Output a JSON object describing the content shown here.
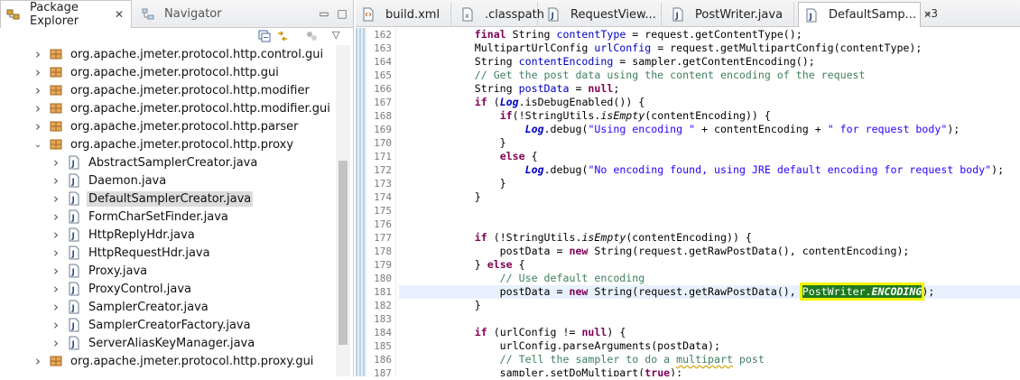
{
  "left_view": {
    "tabs": [
      {
        "label": "Package Explorer",
        "icon": "package-explorer-icon",
        "active": true
      },
      {
        "label": "Navigator",
        "icon": "navigator-icon",
        "active": false
      }
    ],
    "tree": [
      {
        "label": "org.apache.jmeter.protocol.http.control.gui",
        "indent": 1,
        "expander": "collapsed",
        "icon": "package-icon"
      },
      {
        "label": "org.apache.jmeter.protocol.http.gui",
        "indent": 1,
        "expander": "collapsed",
        "icon": "package-icon"
      },
      {
        "label": "org.apache.jmeter.protocol.http.modifier",
        "indent": 1,
        "expander": "collapsed",
        "icon": "package-icon"
      },
      {
        "label": "org.apache.jmeter.protocol.http.modifier.gui",
        "indent": 1,
        "expander": "collapsed",
        "icon": "package-icon"
      },
      {
        "label": "org.apache.jmeter.protocol.http.parser",
        "indent": 1,
        "expander": "collapsed",
        "icon": "package-icon"
      },
      {
        "label": "org.apache.jmeter.protocol.http.proxy",
        "indent": 1,
        "expander": "expanded",
        "icon": "package-icon"
      },
      {
        "label": "AbstractSamplerCreator.java",
        "indent": 2,
        "expander": "collapsed",
        "icon": "java-file-icon"
      },
      {
        "label": "Daemon.java",
        "indent": 2,
        "expander": "collapsed",
        "icon": "java-file-icon"
      },
      {
        "label": "DefaultSamplerCreator.java",
        "indent": 2,
        "expander": "collapsed",
        "icon": "java-file-icon",
        "selected": true
      },
      {
        "label": "FormCharSetFinder.java",
        "indent": 2,
        "expander": "collapsed",
        "icon": "java-file-icon"
      },
      {
        "label": "HttpReplyHdr.java",
        "indent": 2,
        "expander": "collapsed",
        "icon": "java-file-icon"
      },
      {
        "label": "HttpRequestHdr.java",
        "indent": 2,
        "expander": "collapsed",
        "icon": "java-file-icon"
      },
      {
        "label": "Proxy.java",
        "indent": 2,
        "expander": "collapsed",
        "icon": "java-file-icon"
      },
      {
        "label": "ProxyControl.java",
        "indent": 2,
        "expander": "collapsed",
        "icon": "java-file-icon"
      },
      {
        "label": "SamplerCreator.java",
        "indent": 2,
        "expander": "collapsed",
        "icon": "java-file-icon"
      },
      {
        "label": "SamplerCreatorFactory.java",
        "indent": 2,
        "expander": "collapsed",
        "icon": "java-file-icon"
      },
      {
        "label": "ServerAliasKeyManager.java",
        "indent": 2,
        "expander": "collapsed",
        "icon": "java-file-icon"
      },
      {
        "label": "org.apache.jmeter.protocol.http.proxy.gui",
        "indent": 1,
        "expander": "collapsed",
        "icon": "package-icon"
      }
    ]
  },
  "editor": {
    "tabs": [
      {
        "label": "build.xml",
        "icon": "xml-file-icon",
        "active": false
      },
      {
        "label": ".classpath",
        "icon": "classpath-file-icon",
        "active": false
      },
      {
        "label": "RequestView...",
        "icon": "java-file-icon",
        "active": false
      },
      {
        "label": "PostWriter.java",
        "icon": "java-file-icon",
        "active": false
      },
      {
        "label": "DefaultSamp...",
        "icon": "java-file-icon",
        "active": true
      }
    ],
    "more_tabs": "»3",
    "current_line": 181,
    "lines": [
      {
        "n": 162,
        "t": [
          [
            "p",
            "            "
          ],
          [
            "kw",
            "final"
          ],
          [
            "p",
            " String "
          ],
          [
            "fld",
            "contentType"
          ],
          [
            "p",
            " = request.getContentType();"
          ]
        ]
      },
      {
        "n": 163,
        "t": [
          [
            "p",
            "            MultipartUrlConfig "
          ],
          [
            "fld",
            "urlConfig"
          ],
          [
            "p",
            " = request.getMultipartConfig(contentType);"
          ]
        ]
      },
      {
        "n": 164,
        "t": [
          [
            "p",
            "            String "
          ],
          [
            "fld",
            "contentEncoding"
          ],
          [
            "p",
            " = sampler.getContentEncoding();"
          ]
        ]
      },
      {
        "n": 165,
        "t": [
          [
            "cm",
            "            // Get the post data using the content encoding of the request"
          ]
        ]
      },
      {
        "n": 166,
        "t": [
          [
            "p",
            "            String "
          ],
          [
            "fld",
            "postData"
          ],
          [
            "p",
            " = "
          ],
          [
            "kw",
            "null"
          ],
          [
            "p",
            ";"
          ]
        ]
      },
      {
        "n": 167,
        "t": [
          [
            "p",
            "            "
          ],
          [
            "kw",
            "if"
          ],
          [
            "p",
            " ("
          ],
          [
            "sfld",
            "Log"
          ],
          [
            "p",
            ".isDebugEnabled()) {"
          ]
        ]
      },
      {
        "n": 168,
        "t": [
          [
            "p",
            "                "
          ],
          [
            "kw",
            "if"
          ],
          [
            "p",
            "(!StringUtils."
          ],
          [
            "st",
            "isEmpty"
          ],
          [
            "p",
            "(contentEncoding)) {"
          ]
        ]
      },
      {
        "n": 169,
        "t": [
          [
            "p",
            "                    "
          ],
          [
            "sfld",
            "Log"
          ],
          [
            "p",
            ".debug("
          ],
          [
            "str",
            "\"Using encoding \""
          ],
          [
            "p",
            " + contentEncoding + "
          ],
          [
            "str",
            "\" for request body\""
          ],
          [
            "p",
            ");"
          ]
        ]
      },
      {
        "n": 170,
        "t": [
          [
            "p",
            "                }"
          ]
        ]
      },
      {
        "n": 171,
        "t": [
          [
            "p",
            "                "
          ],
          [
            "kw",
            "else"
          ],
          [
            "p",
            " {"
          ]
        ]
      },
      {
        "n": 172,
        "t": [
          [
            "p",
            "                    "
          ],
          [
            "sfld",
            "Log"
          ],
          [
            "p",
            ".debug("
          ],
          [
            "str",
            "\"No encoding found, using JRE default encoding for request body\""
          ],
          [
            "p",
            ");"
          ]
        ]
      },
      {
        "n": 173,
        "t": [
          [
            "p",
            "                }"
          ]
        ]
      },
      {
        "n": 174,
        "t": [
          [
            "p",
            "            }"
          ]
        ]
      },
      {
        "n": 175,
        "t": []
      },
      {
        "n": 176,
        "t": []
      },
      {
        "n": 177,
        "t": [
          [
            "p",
            "            "
          ],
          [
            "kw",
            "if"
          ],
          [
            "p",
            " (!StringUtils."
          ],
          [
            "st",
            "isEmpty"
          ],
          [
            "p",
            "(contentEncoding)) {"
          ]
        ]
      },
      {
        "n": 178,
        "t": [
          [
            "p",
            "                postData = "
          ],
          [
            "kw",
            "new"
          ],
          [
            "p",
            " String(request.getRawPostData(), contentEncoding);"
          ]
        ]
      },
      {
        "n": 179,
        "t": [
          [
            "p",
            "            } "
          ],
          [
            "kw",
            "else"
          ],
          [
            "p",
            " {"
          ]
        ]
      },
      {
        "n": 180,
        "t": [
          [
            "cm",
            "                // Use default encoding"
          ]
        ]
      },
      {
        "n": 181,
        "t": [
          [
            "p",
            "                postData = "
          ],
          [
            "kw",
            "new"
          ],
          [
            "p",
            " String(request.getRawPostData(), "
          ],
          [
            "hl",
            "PostWriter.ENCODING"
          ],
          [
            "p",
            ");"
          ]
        ]
      },
      {
        "n": 182,
        "t": [
          [
            "p",
            "            }"
          ]
        ]
      },
      {
        "n": 183,
        "t": []
      },
      {
        "n": 184,
        "t": [
          [
            "p",
            "            "
          ],
          [
            "kw",
            "if"
          ],
          [
            "p",
            " (urlConfig != "
          ],
          [
            "kw",
            "null"
          ],
          [
            "p",
            ") {"
          ]
        ]
      },
      {
        "n": 185,
        "t": [
          [
            "p",
            "                urlConfig.parseArguments(postData);"
          ]
        ]
      },
      {
        "n": 186,
        "t": [
          [
            "cm",
            "                // Tell the sampler to do a "
          ],
          [
            "cmsq",
            "multipart"
          ],
          [
            "cm",
            " post"
          ]
        ]
      },
      {
        "n": 187,
        "t": [
          [
            "p",
            "                sampler.setDoMultipart("
          ],
          [
            "kw",
            "true"
          ],
          [
            "p",
            ");"
          ]
        ]
      }
    ]
  },
  "colors": {
    "keyword": "#7f0055",
    "field": "#0000c0",
    "string": "#2a00ff",
    "comment": "#3f7f5f",
    "current_line": "#e8f2fe",
    "highlight_bg": "#1f7a1f",
    "highlight_marker": "#f4f400"
  }
}
